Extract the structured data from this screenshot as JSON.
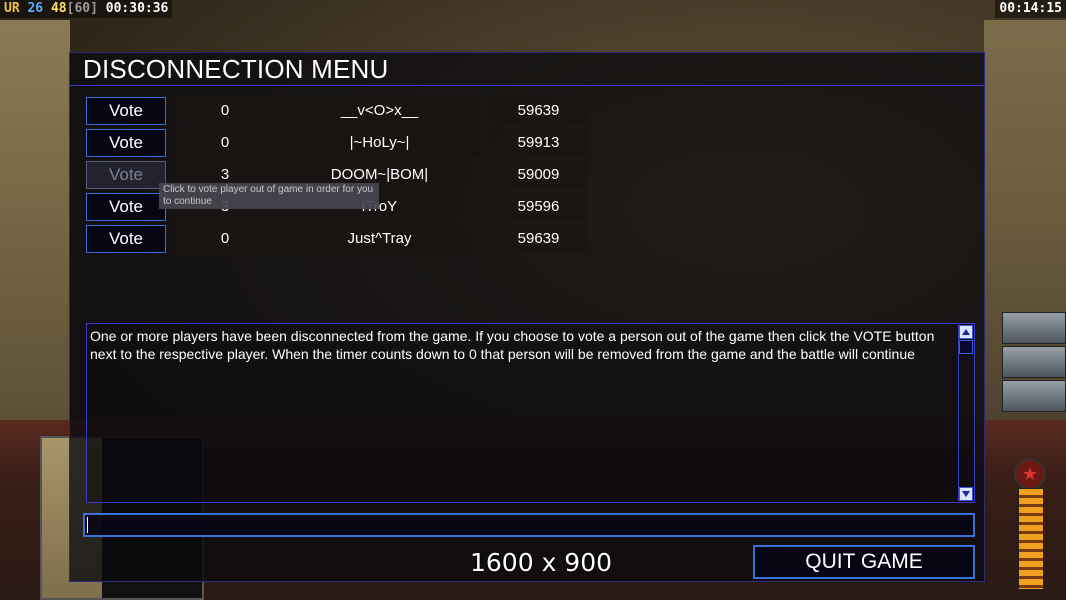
{
  "hud": {
    "left_tag": "UR",
    "left_num1": "26",
    "left_num2": "48",
    "left_bracket": "[60]",
    "left_time": "00:30:36",
    "right_time": "00:14:15"
  },
  "dialog": {
    "title": "DISCONNECTION MENU",
    "players": [
      {
        "vote_label": "Vote",
        "votes": "0",
        "name": "__v<O>x__",
        "ping": "59639",
        "enabled": true
      },
      {
        "vote_label": "Vote",
        "votes": "0",
        "name": "|~HoLy~|",
        "ping": "59913",
        "enabled": true
      },
      {
        "vote_label": "Vote",
        "votes": "3",
        "name": "DOOM~|BOM|",
        "ping": "59009",
        "enabled": false
      },
      {
        "vote_label": "Vote",
        "votes": "3",
        "name": "iTroY",
        "ping": "59596",
        "enabled": true
      },
      {
        "vote_label": "Vote",
        "votes": "0",
        "name": "Just^Tray",
        "ping": "59639",
        "enabled": true
      }
    ],
    "tooltip": "Click to vote player out of game in order for you to continue",
    "message": "One or more players have been disconnected from the game. If you choose to vote a person out of the game then click the VOTE button next to the respective player. When the timer counts down to 0 that person will be removed from the game and the battle will continue",
    "chat_value": "",
    "quit_label": "QUIT GAME"
  },
  "overlay": {
    "resolution": "1600 x 900"
  },
  "colors": {
    "accent_border": "#3a6fd8",
    "title_rule": "#3b3bc8",
    "hud_tag": "#f2c14e",
    "hud_num1": "#5ab0ff",
    "hud_num2": "#ffe066",
    "hud_bracket": "#9a9a9a"
  }
}
